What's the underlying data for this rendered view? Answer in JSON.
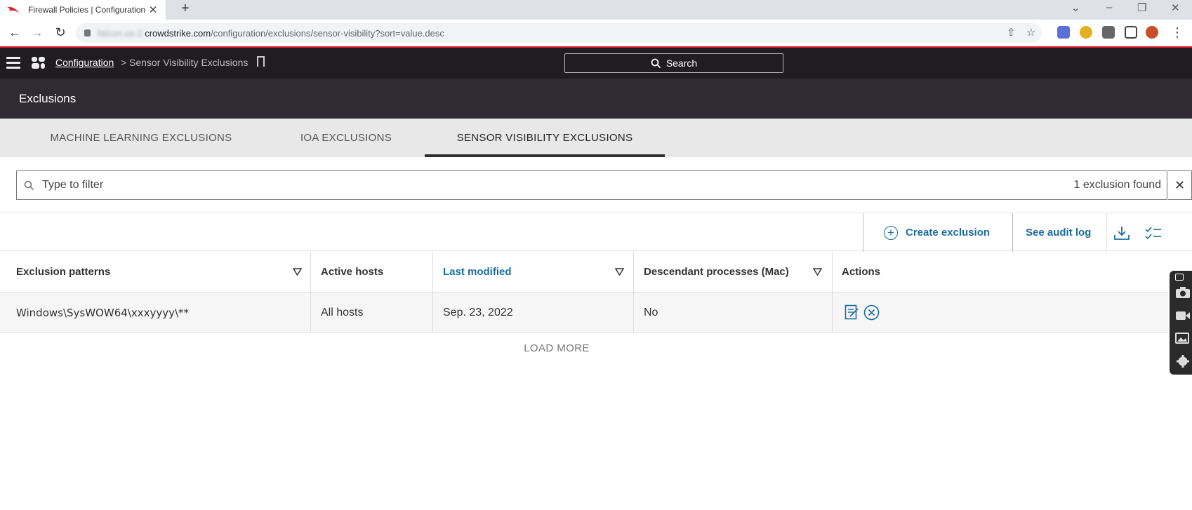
{
  "browser": {
    "tab_title": "Firewall Policies | Configuration |",
    "tab_close": "✕",
    "new_tab": "+",
    "url_blurred": "falcon.us-2.",
    "url_host": "crowdstrike.com",
    "url_path": "/configuration/exclusions/sensor-visibility?sort=value.desc"
  },
  "header": {
    "breadcrumb_parent": "Configuration",
    "breadcrumb_sep": ">",
    "breadcrumb_current": "Sensor Visibility Exclusions",
    "search_label": "Search"
  },
  "page": {
    "title": "Exclusions"
  },
  "tabs": [
    {
      "label": "MACHINE LEARNING EXCLUSIONS",
      "active": false
    },
    {
      "label": "IOA EXCLUSIONS",
      "active": false
    },
    {
      "label": "SENSOR VISIBILITY EXCLUSIONS",
      "active": true
    }
  ],
  "filter": {
    "placeholder": "Type to filter",
    "result_count": "1 exclusion found",
    "clear": "✕"
  },
  "toolbar": {
    "create_label": "Create exclusion",
    "audit_label": "See audit log"
  },
  "table": {
    "columns": [
      "Exclusion patterns",
      "Active hosts",
      "Last modified",
      "Descendant processes (Mac)",
      "Actions"
    ],
    "sorted_column": "Last modified",
    "rows": [
      {
        "pattern": "Windows\\SysWOW64\\xxxyyyy\\**",
        "hosts": "All hosts",
        "modified": "Sep. 23, 2022",
        "descendant": "No"
      }
    ]
  },
  "load_more": "LOAD MORE",
  "colors": {
    "accent": "#1a6d9e",
    "header_bg": "#1f1d20",
    "page_header_bg": "#302b32",
    "tab_bar_bg": "#e8e8e8",
    "browser_red_line": "#e01e26"
  }
}
